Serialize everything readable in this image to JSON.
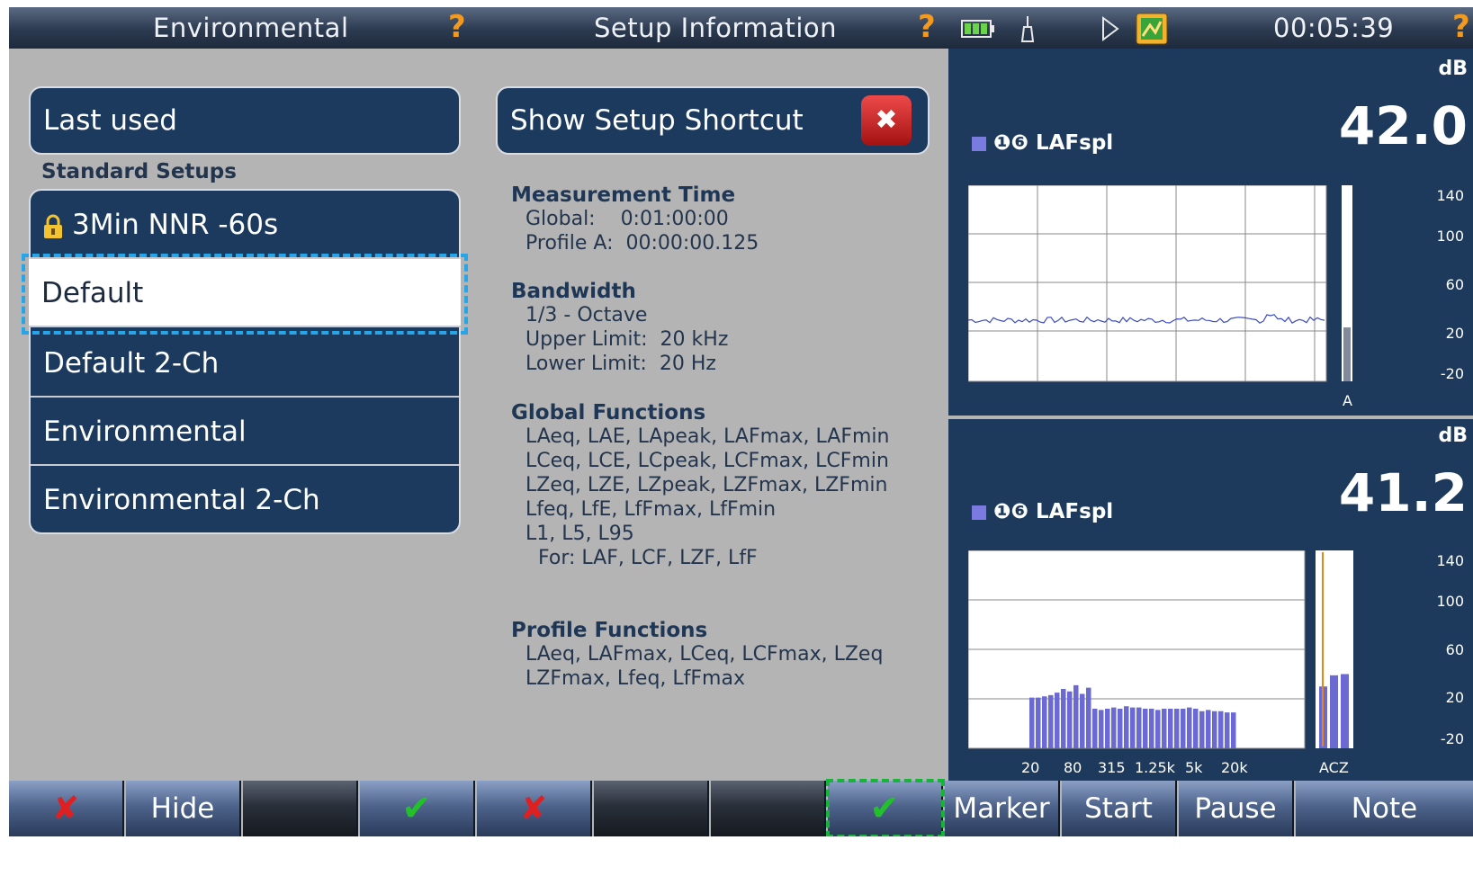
{
  "topbar": {
    "left_title": "Environmental",
    "help_left": "?",
    "center_title": "Setup Information",
    "help_right": "?",
    "time": "00:05:39",
    "help_far": "?",
    "icons": [
      "battery-icon",
      "microphone-icon",
      "play-icon",
      "status-icon"
    ]
  },
  "left": {
    "last_used_label": "Last used",
    "section_label": "Standard Setups",
    "items": [
      {
        "label": "3Min NNR -60s",
        "locked": true
      },
      {
        "label": "Default",
        "selected": true
      },
      {
        "label": "Default 2-Ch"
      },
      {
        "label": "Environmental"
      },
      {
        "label": "Environmental 2-Ch"
      }
    ]
  },
  "shortcut": {
    "label": "Show Setup Shortcut",
    "close_glyph": "✖"
  },
  "info": {
    "measurement_time": {
      "heading": "Measurement Time",
      "lines": [
        "Global:    0:01:00:00",
        "Profile A:  00:00:00.125"
      ]
    },
    "bandwidth": {
      "heading": "Bandwidth",
      "lines": [
        "1/3 - Octave",
        "Upper Limit:  20 kHz",
        "Lower Limit:  20 Hz"
      ]
    },
    "global_functions": {
      "heading": "Global Functions",
      "lines": [
        "LAeq, LAE, LApeak, LAFmax, LAFmin",
        "LCeq, LCE, LCpeak, LCFmax, LCFmin",
        "LZeq, LZE, LZpeak, LZFmax, LZFmin",
        "Lfeq, LfE, LfFmax, LfFmin",
        "L1, L5, L95",
        "  For: LAF, LCF, LZF, LfF"
      ]
    },
    "profile_functions": {
      "heading": "Profile Functions",
      "lines": [
        "LAeq, LAFmax, LCeq, LCFmax, LZeq",
        "LZFmax, Lfeq, LfFmax"
      ]
    }
  },
  "panel1": {
    "unit": "dB",
    "value": "42.0",
    "channel_icons": "❶❻",
    "channel": "LAFspl",
    "y_ticks": [
      "140",
      "100",
      "60",
      "20",
      "-20"
    ],
    "bar_label": "A",
    "bar_level_db": 24,
    "accent_color": "#7a7ae0"
  },
  "panel2": {
    "unit": "dB",
    "value": "41.2",
    "channel_icons": "❶❻",
    "channel": "LAFspl",
    "y_ticks": [
      "140",
      "100",
      "60",
      "20",
      "-20"
    ],
    "x_ticks": [
      "20",
      "80",
      "315",
      "1.25k",
      "5k",
      "20k"
    ],
    "acz_label": "ACZ",
    "spectrum_db": [
      21,
      21,
      22,
      23,
      25,
      28,
      26,
      31,
      24,
      29,
      12,
      11,
      12,
      13,
      12,
      14,
      13,
      13,
      12,
      12,
      11,
      12,
      12,
      12,
      12,
      13,
      12,
      10,
      11,
      10,
      10,
      9,
      9
    ],
    "acz_db": [
      30,
      39,
      40
    ],
    "marker_color": "#e0891a"
  },
  "bottombar": {
    "buttons": [
      {
        "label": "✘",
        "kind": "cancel"
      },
      {
        "label": "Hide"
      },
      {
        "label": "",
        "kind": "dark"
      },
      {
        "label": "✔",
        "kind": "ok"
      },
      {
        "label": "✘",
        "kind": "cancel"
      },
      {
        "label": "",
        "kind": "dark"
      },
      {
        "label": "",
        "kind": "dark"
      },
      {
        "label": "✔",
        "kind": "ok-hl"
      },
      {
        "label": "Marker"
      },
      {
        "label": "Start"
      },
      {
        "label": "Pause"
      },
      {
        "label": "Note"
      }
    ]
  }
}
